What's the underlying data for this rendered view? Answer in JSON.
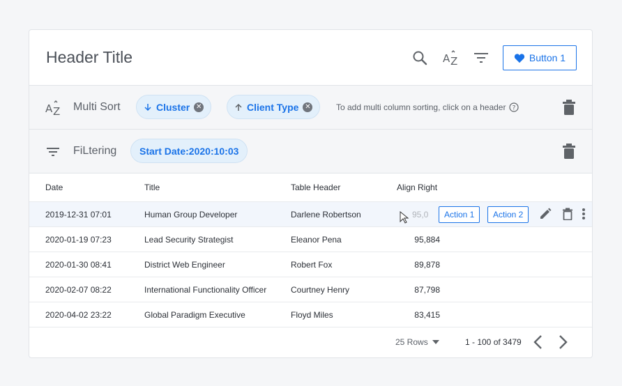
{
  "header": {
    "title": "Header Title",
    "button_label": "Button 1",
    "accent": "#1a73e8"
  },
  "sort": {
    "label": "Multi Sort",
    "chips": [
      {
        "label": "Cluster",
        "direction": "down"
      },
      {
        "label": "Client Type",
        "direction": "up"
      }
    ],
    "hint": "To add multi column sorting, click on a header"
  },
  "filter": {
    "label": "FiLtering",
    "chip": "Start Date:2020:10:03"
  },
  "table": {
    "columns": [
      "Date",
      "Title",
      "Table Header",
      "Align Right"
    ],
    "rows": [
      {
        "date": "2019-12-31 07:01",
        "title": "Human Group Developer",
        "header": "Darlene Robertson",
        "value": "95,0"
      },
      {
        "date": "2020-01-19 07:23",
        "title": "Lead Security Strategist",
        "header": "Eleanor Pena",
        "value": "95,884"
      },
      {
        "date": "2020-01-30 08:41",
        "title": "District Web Engineer",
        "header": "Robert Fox",
        "value": "89,878"
      },
      {
        "date": "2020-02-07 08:22",
        "title": "International Functionality Officer",
        "header": "Courtney Henry",
        "value": "87,798"
      },
      {
        "date": "2020-04-02 23:22",
        "title": "Global Paradigm Executive",
        "header": "Floyd Miles",
        "value": "83,415"
      }
    ],
    "row_actions": [
      "Action 1",
      "Action 2"
    ]
  },
  "footer": {
    "rows_label": "25 Rows",
    "range": "1 - 100 of 3479"
  }
}
